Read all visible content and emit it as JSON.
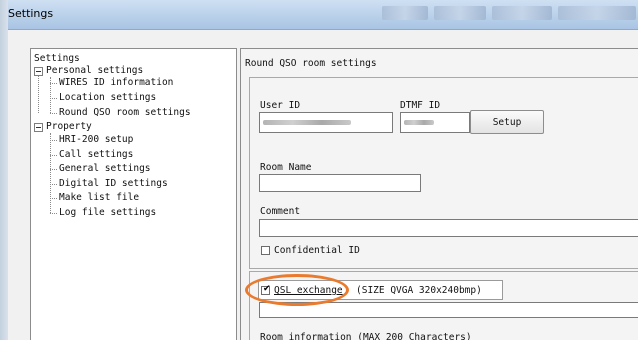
{
  "window": {
    "title": "Settings"
  },
  "tree": {
    "root": "Settings",
    "personal": {
      "label": "Personal settings",
      "children": [
        "WIRES ID information",
        "Location settings",
        "Round QSO room settings"
      ]
    },
    "property": {
      "label": "Property",
      "children": [
        "HRI-200 setup",
        "Call settings",
        "General settings",
        "Digital ID settings",
        "Make list file",
        "Log file settings"
      ]
    }
  },
  "panel": {
    "title": "Round QSO room settings",
    "user_id_label": "User ID",
    "dtmf_id_label": "DTMF ID",
    "setup_button": "Setup",
    "room_name_label": "Room Name",
    "room_name_value": "",
    "comment_label": "Comment",
    "comment_value": "",
    "confidential_label": "Confidential ID",
    "confidential_checked": false,
    "qsl_label": "QSL exchange",
    "qsl_checked": true,
    "qsl_size_note": "(SIZE QVGA 320x240bmp)",
    "room_info_label": "Room information (MAX 200 Characters)"
  },
  "colors": {
    "highlight": "#ea7a2e",
    "titlebar": "#b7cfe9"
  }
}
